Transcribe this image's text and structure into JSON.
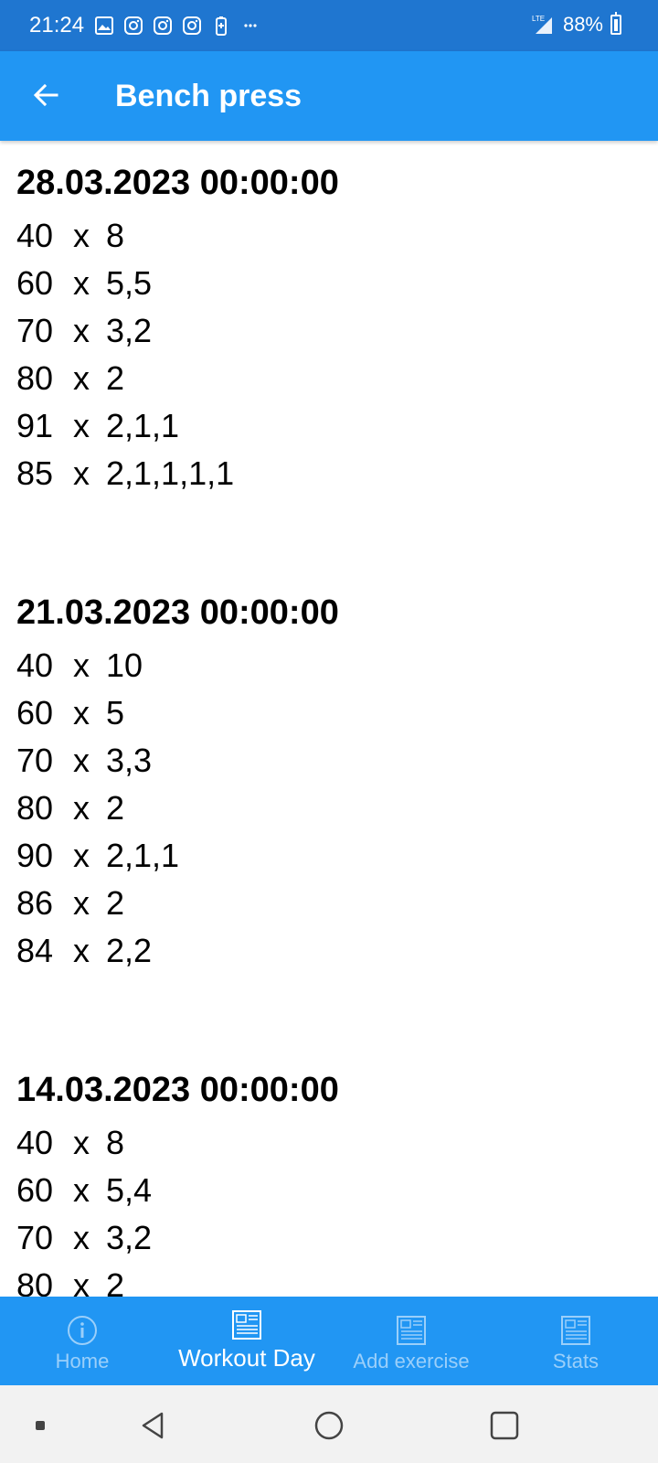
{
  "status_bar": {
    "time": "21:24",
    "battery_percent": "88%",
    "network_label": "LTE",
    "icons": [
      "gallery-icon",
      "instagram-icon",
      "instagram-icon",
      "instagram-icon",
      "battery-saver-icon",
      "more-icon"
    ]
  },
  "app_bar": {
    "title": "Bench press",
    "back_icon": "arrow-left-icon"
  },
  "workouts": [
    {
      "date": "28.03.2023 00:00:00",
      "sets": [
        {
          "weight": "40",
          "reps": "8"
        },
        {
          "weight": "60",
          "reps": "5,5"
        },
        {
          "weight": "70",
          "reps": "3,2"
        },
        {
          "weight": "80",
          "reps": "2"
        },
        {
          "weight": "91",
          "reps": "2,1,1"
        },
        {
          "weight": "85",
          "reps": "2,1,1,1,1"
        }
      ]
    },
    {
      "date": "21.03.2023 00:00:00",
      "sets": [
        {
          "weight": "40",
          "reps": "10"
        },
        {
          "weight": "60",
          "reps": "5"
        },
        {
          "weight": "70",
          "reps": "3,3"
        },
        {
          "weight": "80",
          "reps": "2"
        },
        {
          "weight": "90",
          "reps": "2,1,1"
        },
        {
          "weight": "86",
          "reps": "2"
        },
        {
          "weight": "84",
          "reps": "2,2"
        }
      ]
    },
    {
      "date": "14.03.2023 00:00:00",
      "sets": [
        {
          "weight": "40",
          "reps": "8"
        },
        {
          "weight": "60",
          "reps": "5,4"
        },
        {
          "weight": "70",
          "reps": "3,2"
        },
        {
          "weight": "80",
          "reps": "2"
        }
      ]
    }
  ],
  "set_separator": "x",
  "bottom_nav": {
    "items": [
      {
        "label": "Home",
        "icon": "info-icon",
        "active": false
      },
      {
        "label": "Workout Day",
        "icon": "list-icon",
        "active": true
      },
      {
        "label": "Add exercise",
        "icon": "list-icon",
        "active": false
      },
      {
        "label": "Stats",
        "icon": "list-icon",
        "active": false
      }
    ]
  },
  "colors": {
    "status_bar": "#1f76d0",
    "app_bar": "#2196f3",
    "bottom_nav": "#2196f3",
    "system_nav": "#f2f2f2"
  }
}
